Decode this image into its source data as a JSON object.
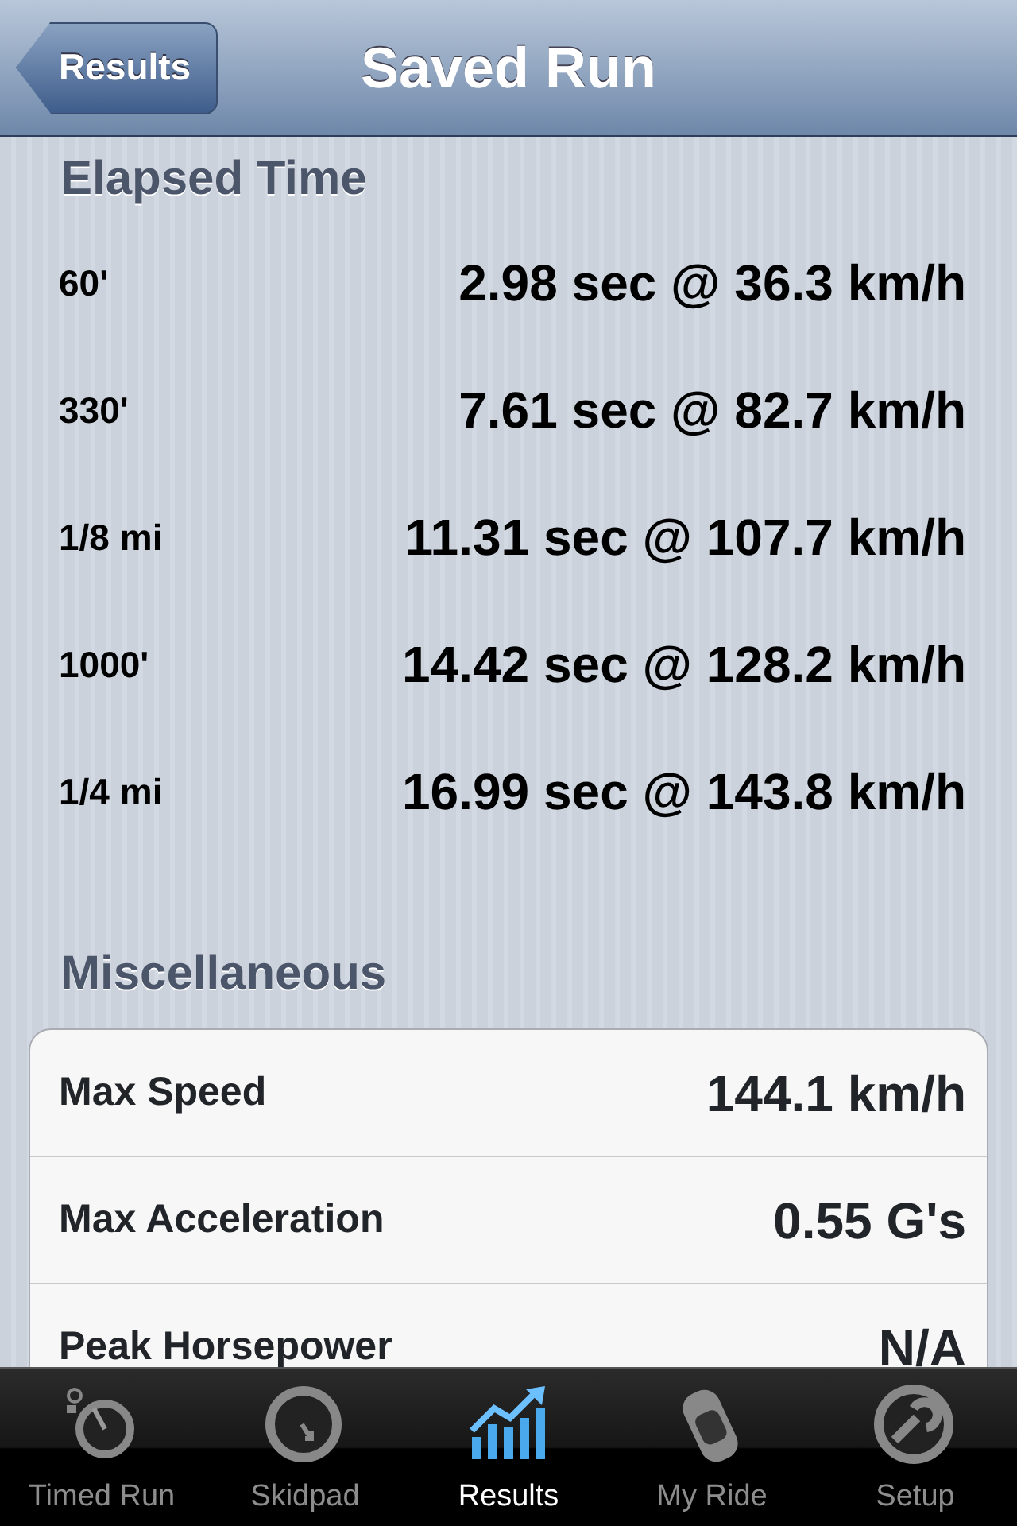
{
  "nav_bar": {
    "back_button": "Results",
    "title": "Saved Run"
  },
  "elapsed_time": {
    "header": "Elapsed Time",
    "rows": [
      {
        "label": "60'",
        "value": "2.98 sec @ 36.3 km/h"
      },
      {
        "label": "330'",
        "value": "7.61 sec @ 82.7 km/h"
      },
      {
        "label": "1/8 mi",
        "value": "11.31 sec @ 107.7 km/h"
      },
      {
        "label": "1000'",
        "value": "14.42 sec @ 128.2 km/h"
      },
      {
        "label": "1/4 mi",
        "value": "16.99 sec @ 143.8 km/h"
      }
    ]
  },
  "miscellaneous": {
    "header": "Miscellaneous",
    "rows": [
      {
        "label": "Max Speed",
        "value": "144.1 km/h"
      },
      {
        "label": "Max Acceleration",
        "value": "0.55 G's"
      },
      {
        "label": "Peak Horsepower",
        "value": "N/A"
      }
    ]
  },
  "tab_bar": [
    {
      "label": "Timed Run",
      "kind": "stopwatch",
      "selected": false
    },
    {
      "label": "Skidpad",
      "kind": "skidpad",
      "selected": false
    },
    {
      "label": "Results",
      "kind": "chart",
      "selected": true
    },
    {
      "label": "My Ride",
      "kind": "car",
      "selected": false
    },
    {
      "label": "Setup",
      "kind": "wrench",
      "selected": false
    }
  ]
}
